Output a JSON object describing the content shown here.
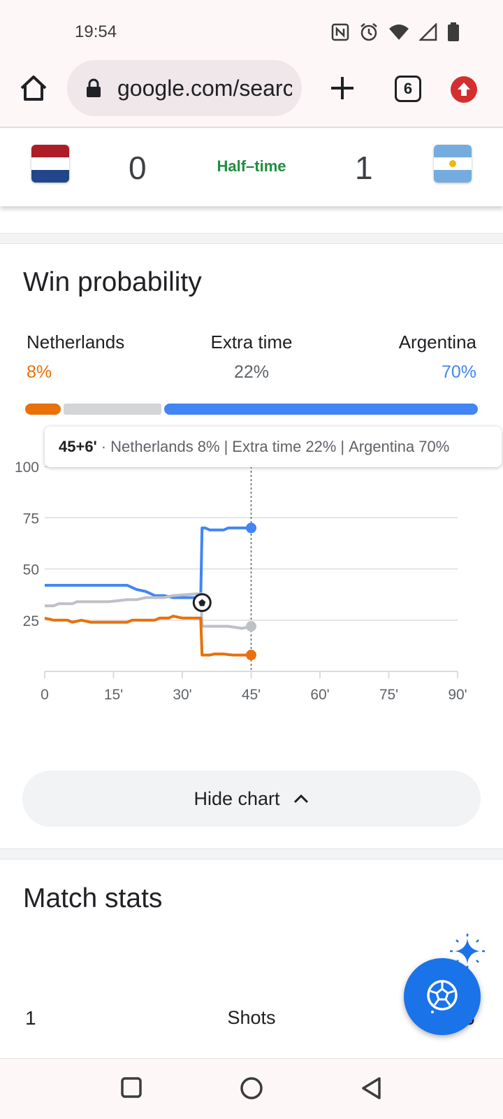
{
  "status_bar": {
    "time": "19:54"
  },
  "browser": {
    "url": "google.com/search",
    "tab_count": "6"
  },
  "match": {
    "home_team": "Netherlands",
    "away_team": "Argentina",
    "home_score": "0",
    "away_score": "1",
    "status": "Half–time"
  },
  "win_probability": {
    "title": "Win probability",
    "home_label": "Netherlands",
    "draw_label": "Extra time",
    "away_label": "Argentina",
    "home_pct": "8%",
    "draw_pct": "22%",
    "away_pct": "70%",
    "tooltip": {
      "time": "45+6'",
      "home": "Netherlands",
      "home_pct": "8%",
      "draw": "Extra time",
      "draw_pct": "22%",
      "away": "Argentina",
      "away_pct": "70%"
    },
    "hide_chart_label": "Hide chart"
  },
  "match_stats": {
    "title": "Match stats",
    "row": {
      "home": "1",
      "label": "Shots",
      "away": "5"
    }
  },
  "colors": {
    "home": "#e8710a",
    "draw": "#bdc1c6",
    "away": "#4285f4",
    "status": "#1e8e3e"
  },
  "chart_data": {
    "type": "line",
    "ylim": [
      0,
      100
    ],
    "xlim": [
      0,
      90
    ],
    "yticks": [
      "100",
      "75",
      "50",
      "25"
    ],
    "xticks": [
      "0",
      "15'",
      "30'",
      "45'",
      "60'",
      "75'",
      "90'"
    ],
    "xtick_values": [
      0,
      15,
      30,
      45,
      60,
      75,
      90
    ],
    "ytick_values": [
      100,
      75,
      50,
      25
    ],
    "series": [
      {
        "name": "Argentina",
        "points": [
          [
            0,
            42
          ],
          [
            18,
            42
          ],
          [
            20,
            40
          ],
          [
            22,
            39
          ],
          [
            24,
            37
          ],
          [
            26,
            37
          ],
          [
            28,
            36
          ],
          [
            31,
            36
          ],
          [
            34,
            36
          ],
          [
            34.3,
            70
          ],
          [
            35,
            70
          ],
          [
            36,
            69
          ],
          [
            39,
            69
          ],
          [
            40,
            70
          ],
          [
            43,
            70
          ],
          [
            45,
            70
          ]
        ]
      },
      {
        "name": "Extra time",
        "points": [
          [
            0,
            32
          ],
          [
            2,
            32
          ],
          [
            3,
            33
          ],
          [
            6,
            33
          ],
          [
            7,
            34
          ],
          [
            9,
            34
          ],
          [
            14,
            34
          ],
          [
            18,
            35
          ],
          [
            20,
            35
          ],
          [
            22,
            36
          ],
          [
            26,
            36
          ],
          [
            28,
            37
          ],
          [
            34,
            38
          ],
          [
            34.3,
            22
          ],
          [
            36,
            22
          ],
          [
            40,
            22
          ],
          [
            43,
            21
          ],
          [
            45,
            22
          ]
        ]
      },
      {
        "name": "Netherlands",
        "points": [
          [
            0,
            26
          ],
          [
            2,
            25
          ],
          [
            5,
            25
          ],
          [
            6,
            24
          ],
          [
            8,
            25
          ],
          [
            10,
            24
          ],
          [
            18,
            24
          ],
          [
            19,
            25
          ],
          [
            24,
            25
          ],
          [
            25,
            26
          ],
          [
            27,
            26
          ],
          [
            28,
            27
          ],
          [
            30,
            26
          ],
          [
            34,
            26
          ],
          [
            34.3,
            8
          ],
          [
            36,
            8
          ],
          [
            37,
            8.5
          ],
          [
            39,
            8.5
          ],
          [
            41,
            8
          ],
          [
            45,
            8
          ]
        ]
      }
    ],
    "goal_marker": {
      "x": 34,
      "y": 37
    },
    "current_x": 45
  }
}
